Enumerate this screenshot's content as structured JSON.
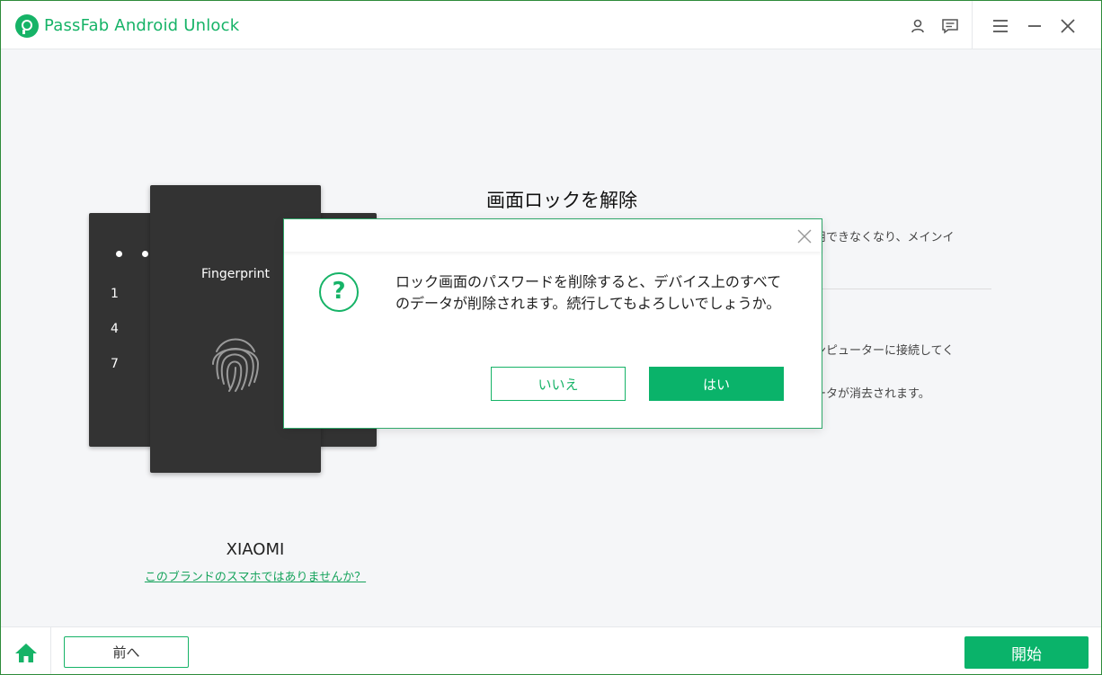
{
  "app": {
    "title": "PassFab Android Unlock",
    "accent": "#16b367"
  },
  "titlebar_icons": [
    "user-icon",
    "feedback-icon",
    "menu-icon",
    "minimize-icon",
    "close-icon"
  ],
  "illustration": {
    "keypad": [
      "1",
      "4",
      "7"
    ],
    "fingerprint_label": "Fingerprint"
  },
  "brand": {
    "name": "XIAOMI",
    "not_this_brand_link": "このブランドのスマホではありませんか？"
  },
  "main": {
    "title": "画面ロックを解除",
    "info_1": "用できなくなり、メインイ",
    "info_2": "ンピューターに接続してく",
    "info_3": "ータが消去されます。"
  },
  "dialog": {
    "message": "ロック画面のパスワードを削除すると、デバイス上のすべてのデータが削除されます。続行してもよろしいでしょうか。",
    "no_label": "いいえ",
    "yes_label": "はい"
  },
  "footer": {
    "back_label": "前へ",
    "start_label": "開始"
  }
}
